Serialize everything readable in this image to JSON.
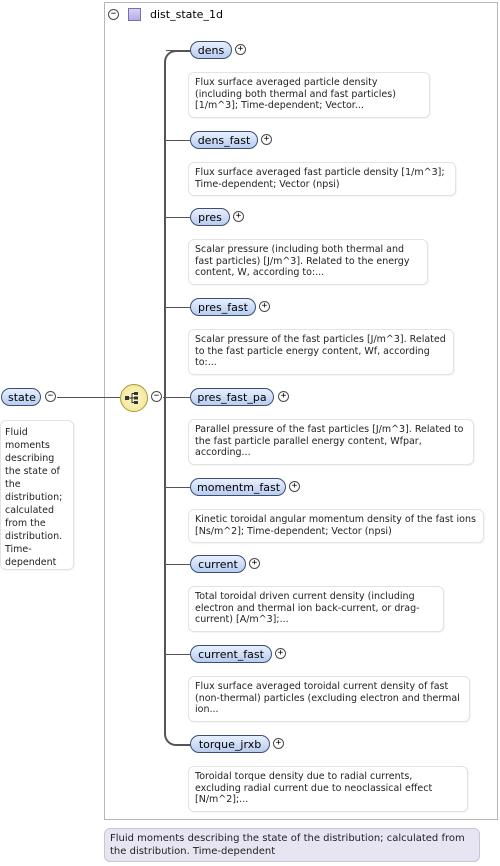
{
  "root": {
    "name": "state",
    "description": "Fluid moments describing the state of the distribution; calculated from the distribution. Time-dependent"
  },
  "group": {
    "name": "dist_state_1d",
    "icon": "complex-type-icon",
    "footer": "Fluid moments describing the state of the distribution; calculated from the distribution. Time-dependent"
  },
  "children": [
    {
      "name": "dens",
      "description": "Flux surface averaged particle density (including both thermal and fast particles) [1/m^3]; Time-dependent; Vector..."
    },
    {
      "name": "dens_fast",
      "description": "Flux surface averaged fast particle density [1/m^3]; Time-dependent; Vector (npsi)"
    },
    {
      "name": "pres",
      "description": "Scalar pressure (including both thermal and fast particles) [J/m^3]. Related to the energy content, W, according to:..."
    },
    {
      "name": "pres_fast",
      "description": "Scalar pressure of the fast particles [J/m^3]. Related to the fast particle energy content, Wf, according to:..."
    },
    {
      "name": "pres_fast_pa",
      "description": "Parallel pressure of the fast particles [J/m^3]. Related to the fast particle parallel energy content, Wfpar, according..."
    },
    {
      "name": "momentm_fast",
      "description": "Kinetic toroidal angular momentum density of the fast ions [Ns/m^2]; Time-dependent; Vector (npsi)"
    },
    {
      "name": "current",
      "description": "Total toroidal driven current density (including electron and thermal ion back-current, or drag-current) [A/m^3];..."
    },
    {
      "name": "current_fast",
      "description": "Flux surface averaged toroidal current density of fast (non-thermal) particles (excluding electron and thermal ion..."
    },
    {
      "name": "torque_jrxb",
      "description": "Toroidal torque density due to radial currents, excluding radial current due to neoclassical effect [N/m^2];..."
    }
  ]
}
